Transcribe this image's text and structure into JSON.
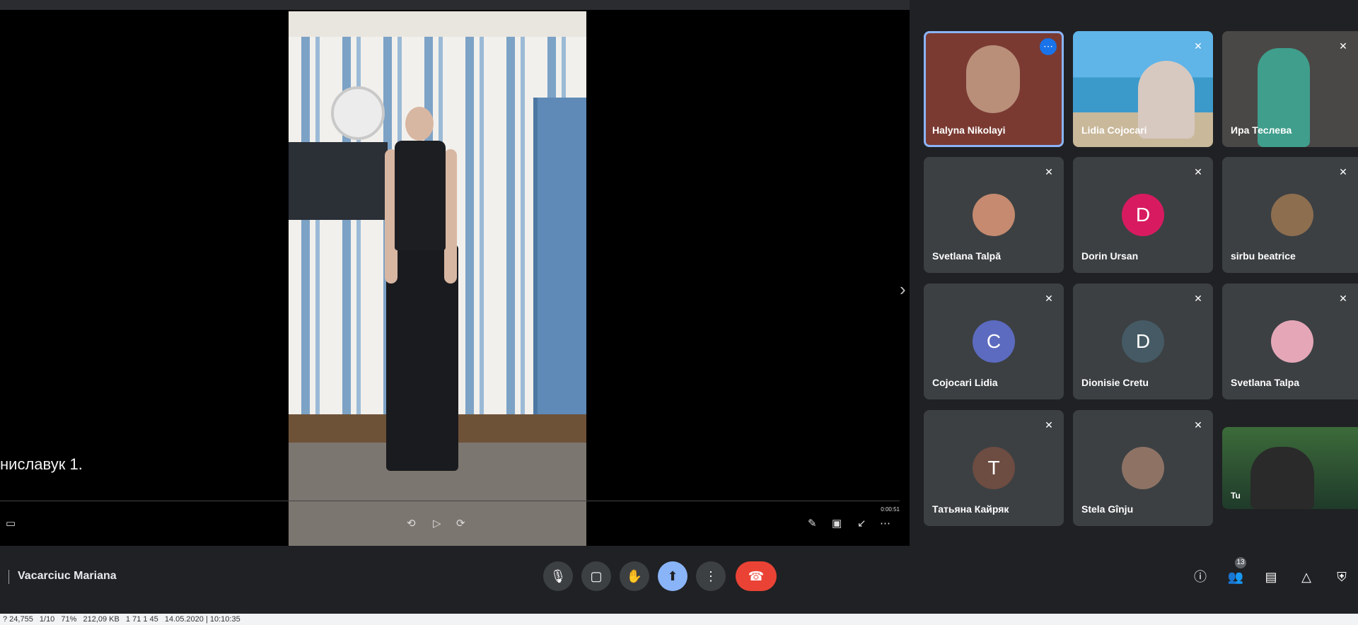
{
  "presentation": {
    "caption": "ниславук 1.",
    "time_label": "0:00:51",
    "controls": [
      "subtitles-icon",
      "rewind-icon",
      "play-icon",
      "forward-icon",
      "pen-icon",
      "captions-icon",
      "exit-fullscreen-icon",
      "more-icon"
    ]
  },
  "participants": [
    {
      "name": "Halyna Nikolayi",
      "type": "video",
      "active": true
    },
    {
      "name": "Lidia Cojocari",
      "type": "video"
    },
    {
      "name": "Ира Теслева",
      "type": "video"
    },
    {
      "name": "Svetlana Talpă",
      "type": "photo",
      "avatar_color": "#c58a6f"
    },
    {
      "name": "Dorin Ursan",
      "type": "letter",
      "letter": "D",
      "avatar_color": "#d81b60"
    },
    {
      "name": "sirbu beatrice",
      "type": "photo",
      "avatar_color": "#8d6e4f"
    },
    {
      "name": "Cojocari Lidia",
      "type": "letter",
      "letter": "C",
      "avatar_color": "#5c6bc0"
    },
    {
      "name": "Dionisie Cretu",
      "type": "letter",
      "letter": "D",
      "avatar_color": "#455a64"
    },
    {
      "name": "Svetlana Talpa",
      "type": "photo",
      "avatar_color": "#e5a7b8"
    },
    {
      "name": "Татьяна Кайряк",
      "type": "letter",
      "letter": "T",
      "avatar_color": "#6d4c41"
    },
    {
      "name": "Stela Gînju",
      "type": "photo",
      "avatar_color": "#8e7365"
    },
    {
      "name": "Tu",
      "type": "video"
    }
  ],
  "toolbar": {
    "meeting_name": "Vacarciuc Mariana",
    "people_count": "13"
  },
  "statusbar": {
    "segments": [
      "?  24,755",
      "1/10",
      "71%",
      "212,09 KB",
      "1 71 1 45",
      "14.05.2020 | 10:10:35"
    ]
  }
}
